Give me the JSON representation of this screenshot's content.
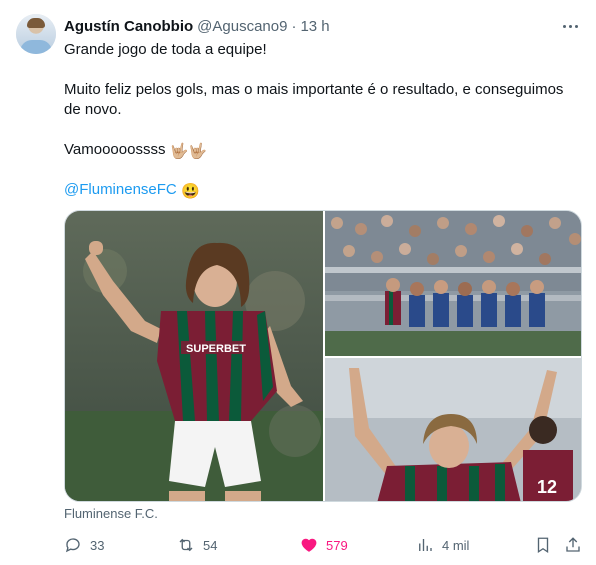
{
  "author": {
    "name": "Agustín Canobbio",
    "handle": "@Aguscano9",
    "separator": "·",
    "time": "13 h"
  },
  "tweet": {
    "line1": "Grande jogo de toda a equipe!",
    "line2": "Muito feliz pelos gols, mas o mais importante é o resultado, e conseguimos de novo.",
    "line3": "Vamooooossss",
    "line3_emoji": "🤟🏼🤟🏼",
    "mention": "@FluminenseFC",
    "mention_emoji": "😃"
  },
  "media": {
    "caption": "Fluminense F.C.",
    "shirt_text": "SUPERBET",
    "shirt_number": "12"
  },
  "actions": {
    "replies": "33",
    "reposts": "54",
    "likes": "579",
    "views": "4 mil"
  },
  "colors": {
    "accent": "#1d9bf0",
    "like": "#f91880",
    "muted": "#536471",
    "fluminense_maroon": "#7b1e34",
    "fluminense_green": "#0b5a3a"
  },
  "icons": [
    "more-icon",
    "reply-icon",
    "repost-icon",
    "like-icon",
    "views-icon",
    "bookmark-icon",
    "share-icon"
  ]
}
